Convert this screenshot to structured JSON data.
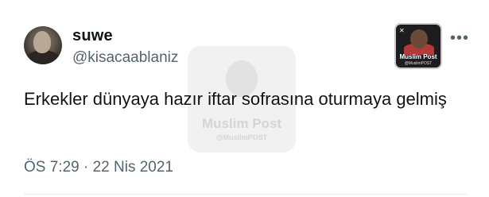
{
  "author": {
    "display_name": "suwe",
    "handle": "@kisacaablaniz"
  },
  "tweet": {
    "text": "Erkekler dünyaya hazır iftar sofrasına oturmaya gelmiş",
    "timestamp": "ÖS 7:29 · 22 Nis 2021"
  },
  "overlay_badge": {
    "name": "Muslim Post",
    "handle": "@MuslimPOST"
  },
  "watermark": {
    "name": "Muslim Post",
    "handle": "@MuslimPOST"
  },
  "menu": {
    "more_label": "•••"
  },
  "icons": {
    "more": "more-options-icon",
    "x_logo": "x-logo-icon"
  },
  "colors": {
    "text_primary": "#0f1419",
    "text_secondary": "#536471",
    "background": "#ffffff"
  }
}
